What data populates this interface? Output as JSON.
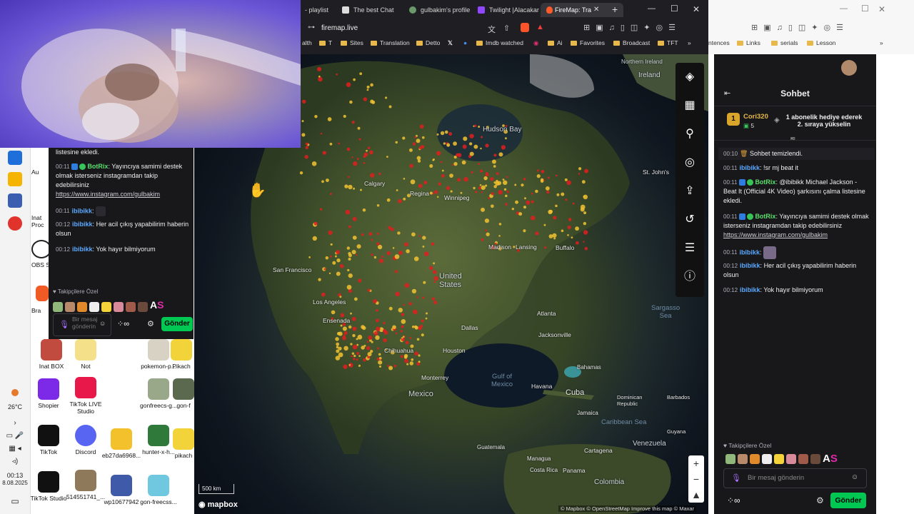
{
  "browser": {
    "tabs": [
      {
        "label": "- playlist"
      },
      {
        "label": "The best Chat"
      },
      {
        "label": "gulbakim's profile"
      },
      {
        "label": "Twilight |Alacakar"
      },
      {
        "label": "FireMap: Tra"
      }
    ],
    "url": "firemap.live",
    "bookmarks": [
      "alth",
      "T",
      "Sites",
      "Translation",
      "Detto",
      "Imdb watched",
      "Ai",
      "Favorites",
      "Broadcast",
      "TFT"
    ],
    "bookmarks2": [
      "ntences",
      "Links",
      "serials",
      "Lesson"
    ],
    "new_tab": "+",
    "win_min": "—",
    "win_max": "☐",
    "win_close": "✕"
  },
  "map": {
    "regions": [
      "Northern Ireland",
      "Ireland",
      "Hudson Bay",
      "United States",
      "Mexico"
    ],
    "cities": [
      "Calgary",
      "Regina",
      "Winnipeg",
      "St. John's",
      "San Francisco",
      "Los Angeles",
      "Ensenada",
      "Chihuahua",
      "Monterrey",
      "Houston",
      "Dallas",
      "Atlanta",
      "Jacksonville",
      "Madison",
      "Lansing",
      "Buffalo",
      "Bahamas",
      "Havana",
      "Cuba",
      "Jamaica",
      "Dominican Republic",
      "Barbados",
      "Caribbean Sea",
      "Venezuela",
      "Cartagena",
      "Panama",
      "Guyana",
      "Colombia",
      "Costa Rica",
      "Managua",
      "Guatemala"
    ],
    "oceans": {
      "gulf": "Gulf of\nMexico",
      "sargasso": "Sargasso\nSea"
    },
    "scale_label": "500 km",
    "logo": "mapbox",
    "attribution": "© Mapbox © OpenStreetMap  Improve this map © Maxar",
    "zoom_in": "+",
    "zoom_out": "−"
  },
  "mini_chat": {
    "lines": [
      {
        "ts": "",
        "user": "",
        "text": "listesine ekledi."
      },
      {
        "ts": "00:11",
        "user": "BotRix",
        "text": "Yayıncıya samimi destek olmak isterseniz instagramdan takip edebilirsiniz",
        "link": "https://www.instagram.com/gulbakim"
      },
      {
        "ts": "00:11",
        "user": "ibibikk",
        "text": ""
      },
      {
        "ts": "00:12",
        "user": "ibibikk",
        "text": "Her acil çıkış yapabilirim haberin olsun"
      },
      {
        "ts": "00:12",
        "user": "ibibikk",
        "text": "Yok hayır bilmiyorum"
      }
    ],
    "followers_label": "Takipçilere Özel",
    "input_placeholder": "Bir mesaj gönderin",
    "send_label": "Gönder"
  },
  "chat": {
    "title": "Sohbet",
    "pinned_user": "Cori320",
    "pinned_count": "5",
    "pinned_rank": "1",
    "pinned_text": "1 abonelik hediye ederek 2. sıraya yükselin",
    "lines": [
      {
        "ts": "00:10",
        "user": "",
        "text": "Sohbet temizlendi."
      },
      {
        "ts": "00:11",
        "user": "ibibikk",
        "text": "!sr mj beat it"
      },
      {
        "ts": "00:11",
        "user": "BotRix",
        "text": "@ibibikk Michael Jackson - Beat It (Official 4K Video) şarkısını çalma listesine ekledi."
      },
      {
        "ts": "00:11",
        "user": "BotRix",
        "text": "Yayıncıya samimi destek olmak isterseniz instagramdan takip edebilirsiniz",
        "link": "https://www.instagram.com/gulbakim"
      },
      {
        "ts": "00:11",
        "user": "ibibikk",
        "text": ""
      },
      {
        "ts": "00:12",
        "user": "ibibikk",
        "text": "Her acil çıkış yapabilirim haberin olsun"
      },
      {
        "ts": "00:12",
        "user": "ibibikk",
        "text": "Yok hayır bilmiyorum"
      }
    ],
    "followers_label": "Takipçilere Özel",
    "input_placeholder": "Bir mesaj gönderin",
    "send_label": "Gönder"
  },
  "desktop": {
    "icons": [
      {
        "label": "Inat BOX"
      },
      {
        "label": "Not"
      },
      {
        "label": "pokemon-p..."
      },
      {
        "label": "Pikach"
      },
      {
        "label": "Shopier"
      },
      {
        "label": "TikTok LIVE Studio"
      },
      {
        "label": "gonfreecs-g..."
      },
      {
        "label": "gon-f"
      },
      {
        "label": "TikTok"
      },
      {
        "label": "Discord"
      },
      {
        "label": "eb27da6968..."
      },
      {
        "label": "hunter-x-h..."
      },
      {
        "label": "pikach"
      },
      {
        "label": "TikTok Studio"
      },
      {
        "label": "514551741_..."
      },
      {
        "label": "wp10677942"
      },
      {
        "label": "gon-freecss..."
      }
    ],
    "left_labels": [
      "Au",
      "Inat Proc",
      "OBS S",
      "Bra"
    ],
    "weather": "26°C",
    "time": "00:13",
    "date": "8.08.2025"
  },
  "colors": {
    "accent_green": "#00c853",
    "chat_bg": "#18181b",
    "user_blue": "#5aa9ff",
    "bot_green": "#58e06a",
    "fire_red": "#e01e1e",
    "fire_yellow": "#f2c230"
  }
}
